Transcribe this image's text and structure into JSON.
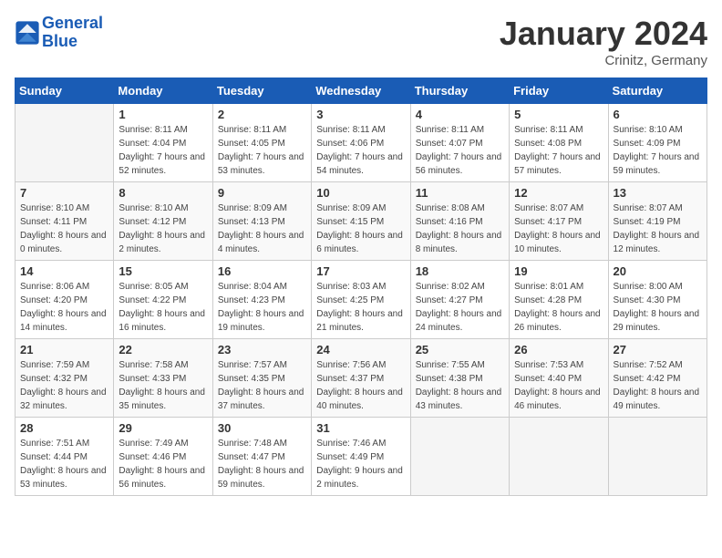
{
  "header": {
    "logo_general": "General",
    "logo_blue": "Blue",
    "month": "January 2024",
    "location": "Crinitz, Germany"
  },
  "days_of_week": [
    "Sunday",
    "Monday",
    "Tuesday",
    "Wednesday",
    "Thursday",
    "Friday",
    "Saturday"
  ],
  "weeks": [
    [
      {
        "day": "",
        "empty": true
      },
      {
        "day": "1",
        "sunrise": "Sunrise: 8:11 AM",
        "sunset": "Sunset: 4:04 PM",
        "daylight": "Daylight: 7 hours and 52 minutes."
      },
      {
        "day": "2",
        "sunrise": "Sunrise: 8:11 AM",
        "sunset": "Sunset: 4:05 PM",
        "daylight": "Daylight: 7 hours and 53 minutes."
      },
      {
        "day": "3",
        "sunrise": "Sunrise: 8:11 AM",
        "sunset": "Sunset: 4:06 PM",
        "daylight": "Daylight: 7 hours and 54 minutes."
      },
      {
        "day": "4",
        "sunrise": "Sunrise: 8:11 AM",
        "sunset": "Sunset: 4:07 PM",
        "daylight": "Daylight: 7 hours and 56 minutes."
      },
      {
        "day": "5",
        "sunrise": "Sunrise: 8:11 AM",
        "sunset": "Sunset: 4:08 PM",
        "daylight": "Daylight: 7 hours and 57 minutes."
      },
      {
        "day": "6",
        "sunrise": "Sunrise: 8:10 AM",
        "sunset": "Sunset: 4:09 PM",
        "daylight": "Daylight: 7 hours and 59 minutes."
      }
    ],
    [
      {
        "day": "7",
        "sunrise": "Sunrise: 8:10 AM",
        "sunset": "Sunset: 4:11 PM",
        "daylight": "Daylight: 8 hours and 0 minutes."
      },
      {
        "day": "8",
        "sunrise": "Sunrise: 8:10 AM",
        "sunset": "Sunset: 4:12 PM",
        "daylight": "Daylight: 8 hours and 2 minutes."
      },
      {
        "day": "9",
        "sunrise": "Sunrise: 8:09 AM",
        "sunset": "Sunset: 4:13 PM",
        "daylight": "Daylight: 8 hours and 4 minutes."
      },
      {
        "day": "10",
        "sunrise": "Sunrise: 8:09 AM",
        "sunset": "Sunset: 4:15 PM",
        "daylight": "Daylight: 8 hours and 6 minutes."
      },
      {
        "day": "11",
        "sunrise": "Sunrise: 8:08 AM",
        "sunset": "Sunset: 4:16 PM",
        "daylight": "Daylight: 8 hours and 8 minutes."
      },
      {
        "day": "12",
        "sunrise": "Sunrise: 8:07 AM",
        "sunset": "Sunset: 4:17 PM",
        "daylight": "Daylight: 8 hours and 10 minutes."
      },
      {
        "day": "13",
        "sunrise": "Sunrise: 8:07 AM",
        "sunset": "Sunset: 4:19 PM",
        "daylight": "Daylight: 8 hours and 12 minutes."
      }
    ],
    [
      {
        "day": "14",
        "sunrise": "Sunrise: 8:06 AM",
        "sunset": "Sunset: 4:20 PM",
        "daylight": "Daylight: 8 hours and 14 minutes."
      },
      {
        "day": "15",
        "sunrise": "Sunrise: 8:05 AM",
        "sunset": "Sunset: 4:22 PM",
        "daylight": "Daylight: 8 hours and 16 minutes."
      },
      {
        "day": "16",
        "sunrise": "Sunrise: 8:04 AM",
        "sunset": "Sunset: 4:23 PM",
        "daylight": "Daylight: 8 hours and 19 minutes."
      },
      {
        "day": "17",
        "sunrise": "Sunrise: 8:03 AM",
        "sunset": "Sunset: 4:25 PM",
        "daylight": "Daylight: 8 hours and 21 minutes."
      },
      {
        "day": "18",
        "sunrise": "Sunrise: 8:02 AM",
        "sunset": "Sunset: 4:27 PM",
        "daylight": "Daylight: 8 hours and 24 minutes."
      },
      {
        "day": "19",
        "sunrise": "Sunrise: 8:01 AM",
        "sunset": "Sunset: 4:28 PM",
        "daylight": "Daylight: 8 hours and 26 minutes."
      },
      {
        "day": "20",
        "sunrise": "Sunrise: 8:00 AM",
        "sunset": "Sunset: 4:30 PM",
        "daylight": "Daylight: 8 hours and 29 minutes."
      }
    ],
    [
      {
        "day": "21",
        "sunrise": "Sunrise: 7:59 AM",
        "sunset": "Sunset: 4:32 PM",
        "daylight": "Daylight: 8 hours and 32 minutes."
      },
      {
        "day": "22",
        "sunrise": "Sunrise: 7:58 AM",
        "sunset": "Sunset: 4:33 PM",
        "daylight": "Daylight: 8 hours and 35 minutes."
      },
      {
        "day": "23",
        "sunrise": "Sunrise: 7:57 AM",
        "sunset": "Sunset: 4:35 PM",
        "daylight": "Daylight: 8 hours and 37 minutes."
      },
      {
        "day": "24",
        "sunrise": "Sunrise: 7:56 AM",
        "sunset": "Sunset: 4:37 PM",
        "daylight": "Daylight: 8 hours and 40 minutes."
      },
      {
        "day": "25",
        "sunrise": "Sunrise: 7:55 AM",
        "sunset": "Sunset: 4:38 PM",
        "daylight": "Daylight: 8 hours and 43 minutes."
      },
      {
        "day": "26",
        "sunrise": "Sunrise: 7:53 AM",
        "sunset": "Sunset: 4:40 PM",
        "daylight": "Daylight: 8 hours and 46 minutes."
      },
      {
        "day": "27",
        "sunrise": "Sunrise: 7:52 AM",
        "sunset": "Sunset: 4:42 PM",
        "daylight": "Daylight: 8 hours and 49 minutes."
      }
    ],
    [
      {
        "day": "28",
        "sunrise": "Sunrise: 7:51 AM",
        "sunset": "Sunset: 4:44 PM",
        "daylight": "Daylight: 8 hours and 53 minutes."
      },
      {
        "day": "29",
        "sunrise": "Sunrise: 7:49 AM",
        "sunset": "Sunset: 4:46 PM",
        "daylight": "Daylight: 8 hours and 56 minutes."
      },
      {
        "day": "30",
        "sunrise": "Sunrise: 7:48 AM",
        "sunset": "Sunset: 4:47 PM",
        "daylight": "Daylight: 8 hours and 59 minutes."
      },
      {
        "day": "31",
        "sunrise": "Sunrise: 7:46 AM",
        "sunset": "Sunset: 4:49 PM",
        "daylight": "Daylight: 9 hours and 2 minutes."
      },
      {
        "day": "",
        "empty": true
      },
      {
        "day": "",
        "empty": true
      },
      {
        "day": "",
        "empty": true
      }
    ]
  ]
}
